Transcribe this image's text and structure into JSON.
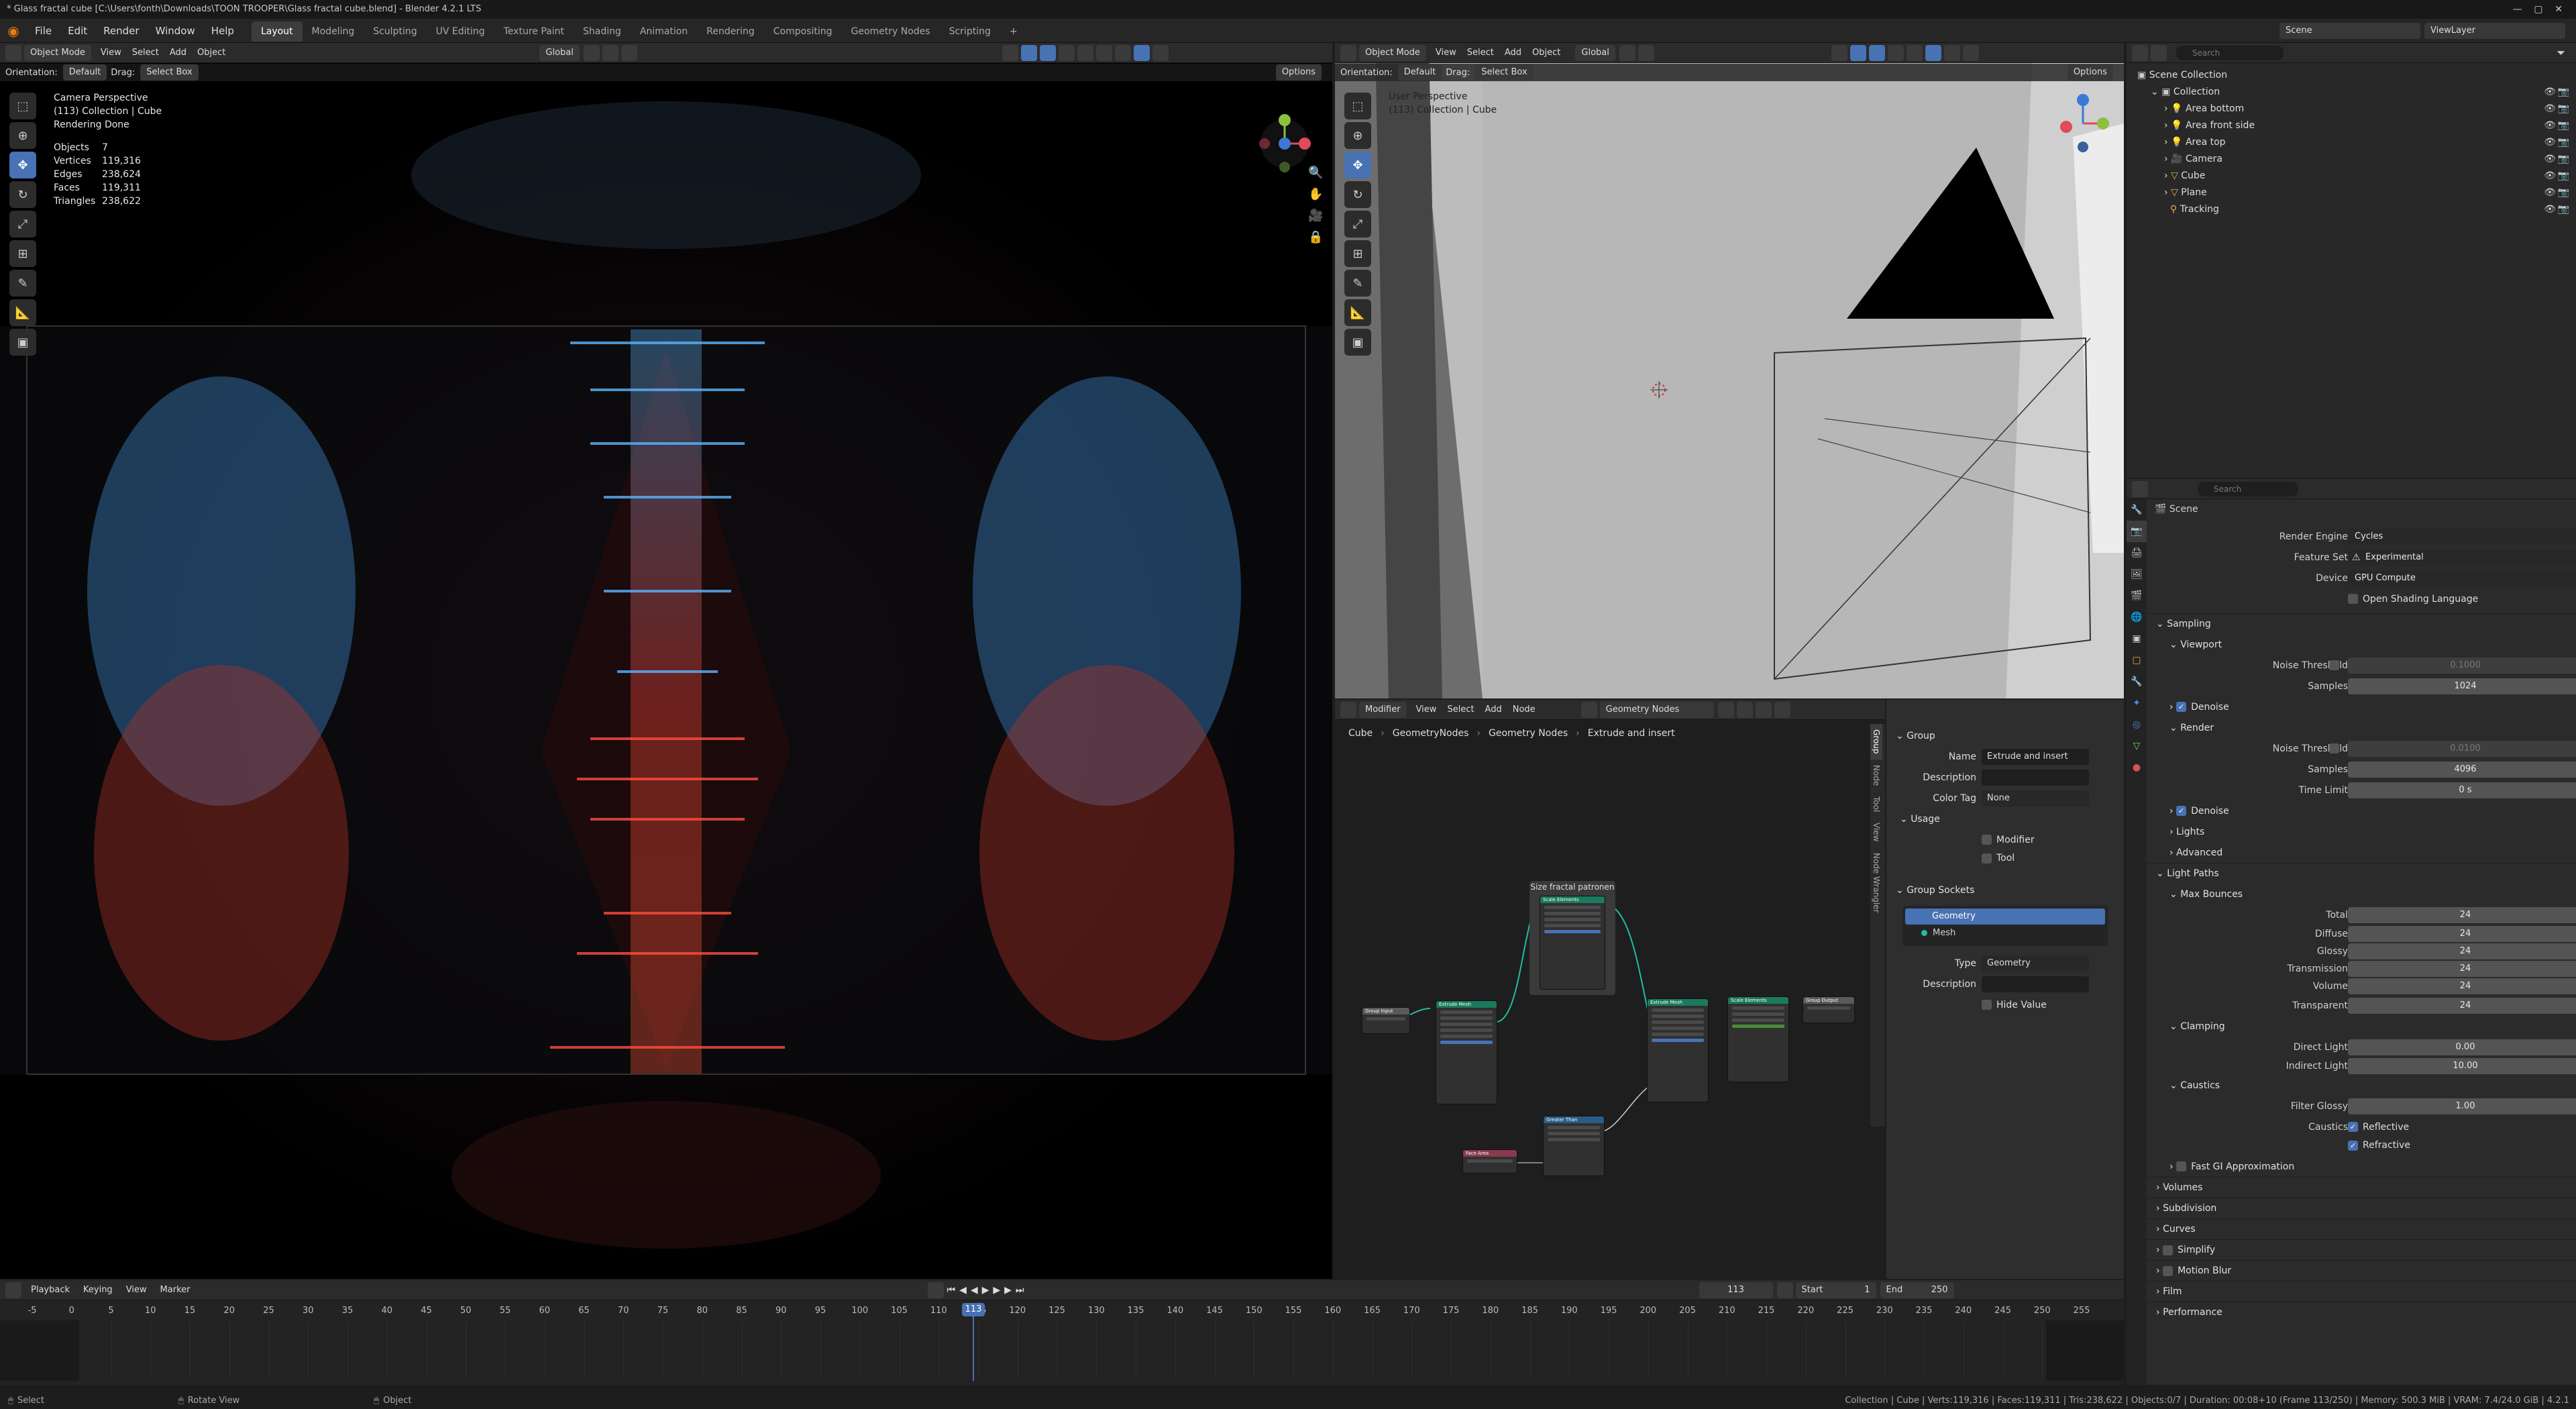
{
  "window": {
    "title": "* Glass fractal cube [C:\\Users\\fonth\\Downloads\\TOON TROOPER\\Glass fractal cube.blend] - Blender 4.2.1 LTS"
  },
  "menus": [
    "File",
    "Edit",
    "Render",
    "Window",
    "Help"
  ],
  "workspaces": [
    "Layout",
    "Modeling",
    "Sculpting",
    "UV Editing",
    "Texture Paint",
    "Shading",
    "Animation",
    "Rendering",
    "Compositing",
    "Geometry Nodes",
    "Scripting"
  ],
  "active_workspace": "Layout",
  "top_right": {
    "scene": "Scene",
    "view_layer": "ViewLayer"
  },
  "viewport_left": {
    "mode": "Object Mode",
    "menus": [
      "View",
      "Select",
      "Add",
      "Object"
    ],
    "transform": "Global",
    "options": "Options",
    "orientation_label": "Orientation:",
    "orientation_value": "Default",
    "drag_label": "Drag:",
    "drag_value": "Select Box",
    "overlay_title": "Camera Perspective",
    "overlay_collection": "(113) Collection | Cube",
    "overlay_status": "Rendering Done",
    "stats": [
      {
        "label": "Objects",
        "value": "7"
      },
      {
        "label": "Vertices",
        "value": "119,316"
      },
      {
        "label": "Edges",
        "value": "238,624"
      },
      {
        "label": "Faces",
        "value": "119,311"
      },
      {
        "label": "Triangles",
        "value": "238,622"
      }
    ]
  },
  "viewport_right": {
    "mode": "Object Mode",
    "menus": [
      "View",
      "Select",
      "Add",
      "Object"
    ],
    "transform": "Global",
    "options": "Options",
    "orientation_label": "Orientation:",
    "orientation_value": "Default",
    "drag_label": "Drag:",
    "drag_value": "Select Box",
    "overlay_title": "User Perspective",
    "overlay_collection": "(113) Collection | Cube"
  },
  "node_editor": {
    "type": "Modifier",
    "menus": [
      "View",
      "Select",
      "Add",
      "Node"
    ],
    "tree_name": "Geometry Nodes",
    "breadcrumb": [
      "Cube",
      "GeometryNodes",
      "Geometry Nodes",
      "Extrude and insert"
    ],
    "frame_label": "Size fractal patronen",
    "side_tabs": [
      "Group",
      "Node",
      "Tool",
      "View",
      "Node Wrangler"
    ],
    "nodes": {
      "group_input": "Group Input",
      "extrude1": "Extrude Mesh",
      "scale": "Scale Elements",
      "extrude2": "Extrude Mesh",
      "scale2": "Scale Elements",
      "group_output": "Group Output",
      "greater": "Greater Than",
      "face_area": "Face Area"
    }
  },
  "node_sidebar": {
    "group_section": "Group",
    "name_label": "Name",
    "name_value": "Extrude and insert",
    "description_label": "Description",
    "color_tag_label": "Color Tag",
    "color_tag_value": "None",
    "usage_section": "Usage",
    "usage_modifier": "Modifier",
    "usage_tool": "Tool",
    "sockets_section": "Group Sockets",
    "sockets": [
      "Geometry",
      "Mesh"
    ],
    "type_label": "Type",
    "type_value": "Geometry",
    "desc2_label": "Description",
    "hide_value": "Hide Value"
  },
  "outliner": {
    "root": "Scene Collection",
    "collection": "Collection",
    "items": [
      "Area bottom",
      "Area front side",
      "Area top",
      "Camera",
      "Cube",
      "Plane",
      "Tracking"
    ],
    "search_placeholder": "Search"
  },
  "properties": {
    "search_placeholder": "Search",
    "context": "Scene",
    "render_engine_label": "Render Engine",
    "render_engine": "Cycles",
    "feature_set_label": "Feature Set",
    "feature_set": "Experimental",
    "device_label": "Device",
    "device": "GPU Compute",
    "osl": "Open Shading Language",
    "sampling": "Sampling",
    "viewport": "Viewport",
    "noise_threshold_label": "Noise Threshold",
    "viewport_noise": "0.1000",
    "samples_label": "Samples",
    "viewport_samples": "1024",
    "denoise": "Denoise",
    "render": "Render",
    "render_noise": "0.0100",
    "render_samples": "4096",
    "time_limit_label": "Time Limit",
    "time_limit": "0 s",
    "lights": "Lights",
    "advanced": "Advanced",
    "light_paths": "Light Paths",
    "max_bounces": "Max Bounces",
    "bounces": [
      {
        "label": "Total",
        "value": "24"
      },
      {
        "label": "Diffuse",
        "value": "24"
      },
      {
        "label": "Glossy",
        "value": "24"
      },
      {
        "label": "Transmission",
        "value": "24"
      },
      {
        "label": "Volume",
        "value": "24"
      },
      {
        "label": "Transparent",
        "value": "24"
      }
    ],
    "clamping": "Clamping",
    "direct_light_label": "Direct Light",
    "direct_light": "0.00",
    "indirect_light_label": "Indirect Light",
    "indirect_light": "10.00",
    "caustics": "Caustics",
    "filter_glossy_label": "Filter Glossy",
    "filter_glossy": "1.00",
    "caustics_label": "Caustics",
    "reflective": "Reflective",
    "refractive": "Refractive",
    "fast_gi": "Fast GI Approximation",
    "more_sections": [
      "Volumes",
      "Subdivision",
      "Curves",
      "Simplify",
      "Motion Blur",
      "Film",
      "Performance"
    ]
  },
  "timeline": {
    "menus": [
      "Playback",
      "Keying",
      "View",
      "Marker"
    ],
    "current_frame": "113",
    "start_label": "Start",
    "start": "1",
    "end_label": "End",
    "end": "250",
    "ticks": [
      "-5",
      "0",
      "5",
      "10",
      "15",
      "20",
      "25",
      "30",
      "35",
      "40",
      "45",
      "50",
      "55",
      "60",
      "65",
      "70",
      "75",
      "80",
      "85",
      "90",
      "95",
      "100",
      "105",
      "110",
      "115",
      "120",
      "125",
      "130",
      "135",
      "140",
      "145",
      "150",
      "155",
      "160",
      "165",
      "170",
      "175",
      "180",
      "185",
      "190",
      "195",
      "200",
      "205",
      "210",
      "215",
      "220",
      "225",
      "230",
      "235",
      "240",
      "245",
      "250",
      "255"
    ]
  },
  "statusbar": {
    "left1": "Select",
    "left2": "Rotate View",
    "left3": "Object",
    "right": "Collection | Cube | Verts:119,316 | Faces:119,311 | Tris:238,622 | Objects:0/7 | Duration: 00:08+10 (Frame 113/250) | Memory: 500.3 MiB | VRAM: 7.4/24.0 GiB | 4.2.1"
  }
}
